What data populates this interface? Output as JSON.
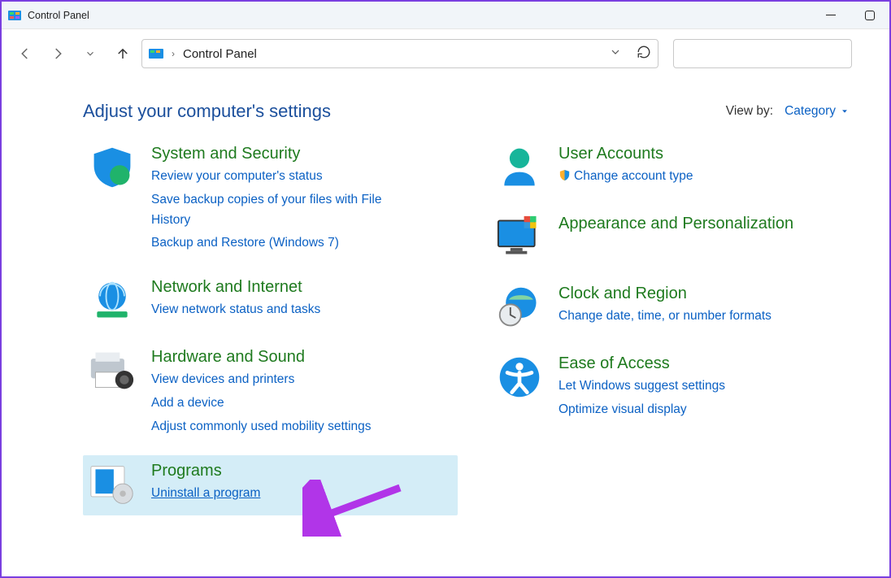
{
  "window": {
    "title": "Control Panel"
  },
  "addressbar": {
    "path": "Control Panel"
  },
  "heading": "Adjust your computer's settings",
  "viewby": {
    "label": "View by:",
    "value": "Category"
  },
  "left": {
    "system": {
      "title": "System and Security",
      "links": [
        "Review your computer's status",
        "Save backup copies of your files with File History",
        "Backup and Restore (Windows 7)"
      ]
    },
    "network": {
      "title": "Network and Internet",
      "links": [
        "View network status and tasks"
      ]
    },
    "hardware": {
      "title": "Hardware and Sound",
      "links": [
        "View devices and printers",
        "Add a device",
        "Adjust commonly used mobility settings"
      ]
    },
    "programs": {
      "title": "Programs",
      "links": [
        "Uninstall a program"
      ]
    }
  },
  "right": {
    "users": {
      "title": "User Accounts",
      "links": [
        "Change account type"
      ]
    },
    "appearance": {
      "title": "Appearance and Personalization"
    },
    "clock": {
      "title": "Clock and Region",
      "links": [
        "Change date, time, or number formats"
      ]
    },
    "ease": {
      "title": "Ease of Access",
      "links": [
        "Let Windows suggest settings",
        "Optimize visual display"
      ]
    }
  }
}
